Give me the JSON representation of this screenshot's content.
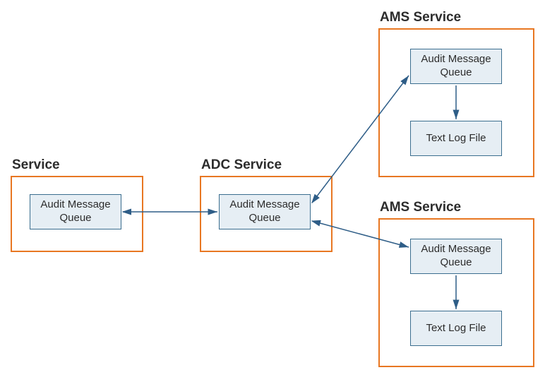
{
  "groups": {
    "service": {
      "title": "Service"
    },
    "adc": {
      "title": "ADC Service"
    },
    "ams1": {
      "title": "AMS Service"
    },
    "ams2": {
      "title": "AMS Service"
    }
  },
  "nodes": {
    "amq": "Audit Message Queue",
    "tlf": "Text Log File"
  },
  "colors": {
    "groupBorder": "#e87722",
    "nodeBorder": "#3b6e8f",
    "nodeFill": "#e6eef4",
    "arrow": "#2e5d87"
  }
}
